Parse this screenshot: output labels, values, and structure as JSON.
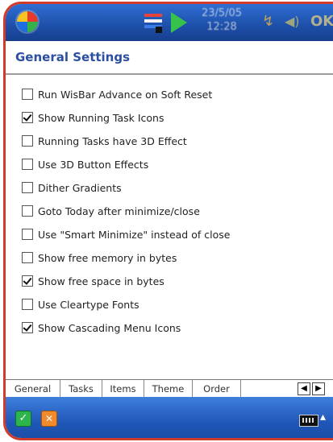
{
  "statusbar": {
    "clock_date": "23/5/05",
    "clock_time": "12:28",
    "ok_label": "OK"
  },
  "title": "General Settings",
  "options": [
    {
      "label": "Run WisBar Advance on Soft Reset",
      "checked": false
    },
    {
      "label": "Show Running Task Icons",
      "checked": true
    },
    {
      "label": "Running Tasks have 3D Effect",
      "checked": false
    },
    {
      "label": "Use 3D Button Effects",
      "checked": false
    },
    {
      "label": "Dither Gradients",
      "checked": false
    },
    {
      "label": "Goto Today after minimize/close",
      "checked": false
    },
    {
      "label": "Use \"Smart Minimize\" instead of close",
      "checked": false
    },
    {
      "label": "Show free memory in bytes",
      "checked": false
    },
    {
      "label": "Show free space in bytes",
      "checked": true
    },
    {
      "label": "Use Cleartype Fonts",
      "checked": false
    },
    {
      "label": "Show Cascading Menu Icons",
      "checked": true
    }
  ],
  "tabs": [
    {
      "label": "General",
      "active": true
    },
    {
      "label": "Tasks",
      "active": false
    },
    {
      "label": "Items",
      "active": false
    },
    {
      "label": "Theme",
      "active": false
    },
    {
      "label": "Order",
      "active": false
    }
  ],
  "icons": {
    "start": "windows-flag-icon",
    "wisbar": "wisbar-icon",
    "play": "play-icon",
    "signal": "signal-icon",
    "volume": "volume-icon",
    "ok_button": "check-icon",
    "close_button": "close-icon",
    "keyboard": "keyboard-icon"
  },
  "colors": {
    "taskbar": "#1d4fa8",
    "title": "#2c4fa3",
    "frame": "#d23a2a"
  }
}
